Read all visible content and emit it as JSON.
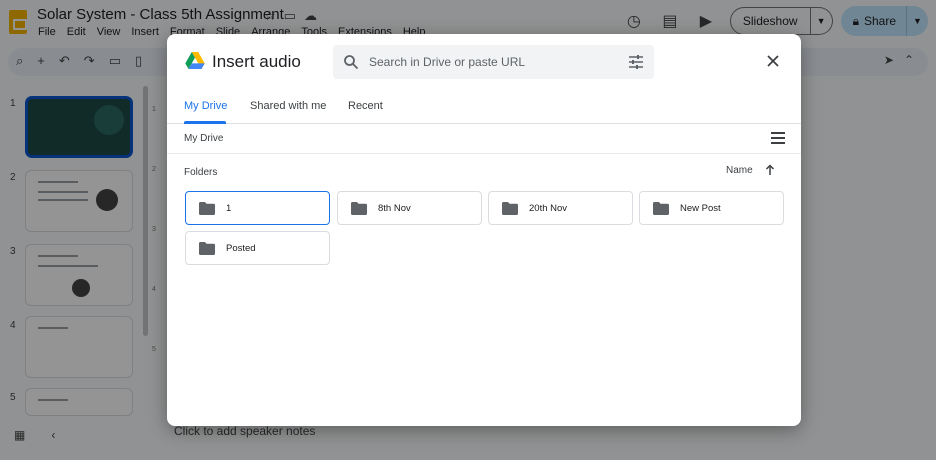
{
  "app": {
    "title": "Solar System - Class  5th Assignment",
    "menu": [
      "File",
      "Edit",
      "View",
      "Insert",
      "Format",
      "Slide",
      "Arrange",
      "Tools",
      "Extensions",
      "Help"
    ],
    "slideshow_label": "Slideshow",
    "share_label": "Share",
    "speaker_notes": "Click to add speaker notes",
    "slide_numbers": [
      "1",
      "2",
      "3",
      "4",
      "5"
    ],
    "ruler_marks": [
      "1",
      "2",
      "3",
      "4",
      "5"
    ]
  },
  "dialog": {
    "title": "Insert audio",
    "search_placeholder": "Search in Drive or paste URL",
    "tabs": [
      {
        "label": "My Drive",
        "active": true
      },
      {
        "label": "Shared with me",
        "active": false
      },
      {
        "label": "Recent",
        "active": false
      }
    ],
    "breadcrumb": "My Drive",
    "folders_label": "Folders",
    "sort_label": "Name",
    "folders": [
      {
        "name": "1",
        "selected": true
      },
      {
        "name": "8th Nov",
        "selected": false
      },
      {
        "name": "20th Nov",
        "selected": false
      },
      {
        "name": "New Post",
        "selected": false
      },
      {
        "name": "Posted",
        "selected": false
      }
    ]
  },
  "colors": {
    "accent": "#1a73e8",
    "folder_icon": "#5f6368",
    "share_button": "#c2e7ff"
  }
}
